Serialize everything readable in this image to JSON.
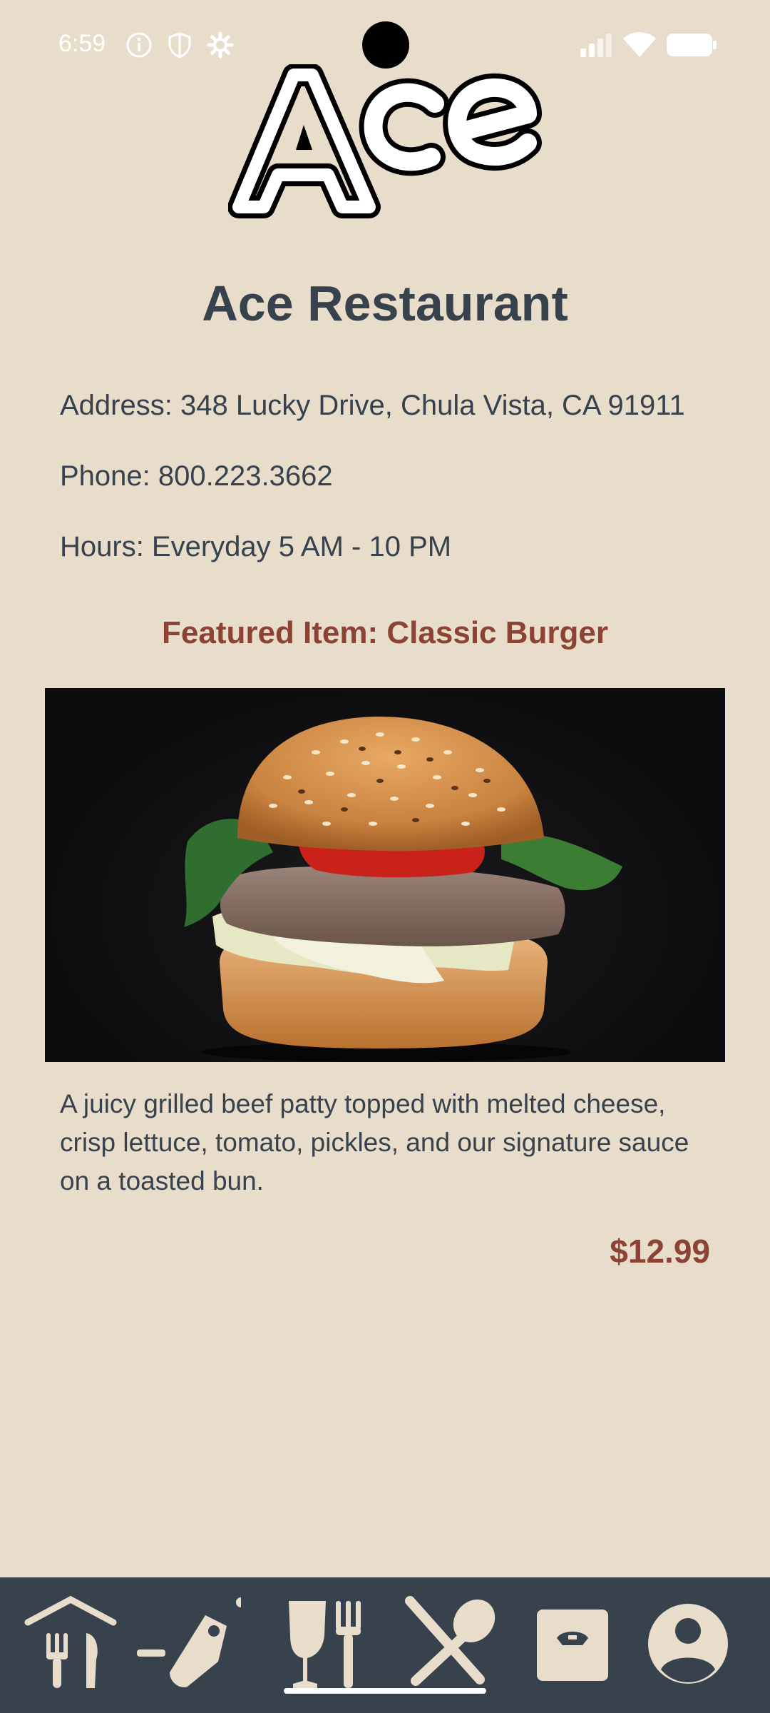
{
  "status_bar": {
    "time": "6:59",
    "left_icons": [
      "info-icon",
      "shield-icon",
      "gear-icon"
    ],
    "right_icons": [
      "signal-icon",
      "wifi-icon",
      "battery-icon"
    ]
  },
  "restaurant": {
    "name": "Ace Restaurant",
    "address": "Address: 348 Lucky Drive, Chula Vista, CA 91911",
    "phone": "Phone: 800.223.3662",
    "hours": "Hours: Everyday 5 AM - 10 PM"
  },
  "featured": {
    "heading": "Featured Item: Classic Burger",
    "description": "A juicy grilled beef patty topped with melted cheese, crisp lettuce, tomato, pickles, and our signature sauce on a toasted bun.",
    "price": "$12.99"
  },
  "nav": {
    "items": [
      "restaurant-home-icon",
      "specials-tag-icon",
      "drinks-icon",
      "menu-icon",
      "order-box-icon",
      "profile-icon"
    ],
    "selected": "menu-icon"
  },
  "colors": {
    "background": "#E8DCCA",
    "text": "#37424D",
    "accent": "#8C4234",
    "nav_background": "#37424D",
    "nav_icon": "#E8DCCA"
  }
}
